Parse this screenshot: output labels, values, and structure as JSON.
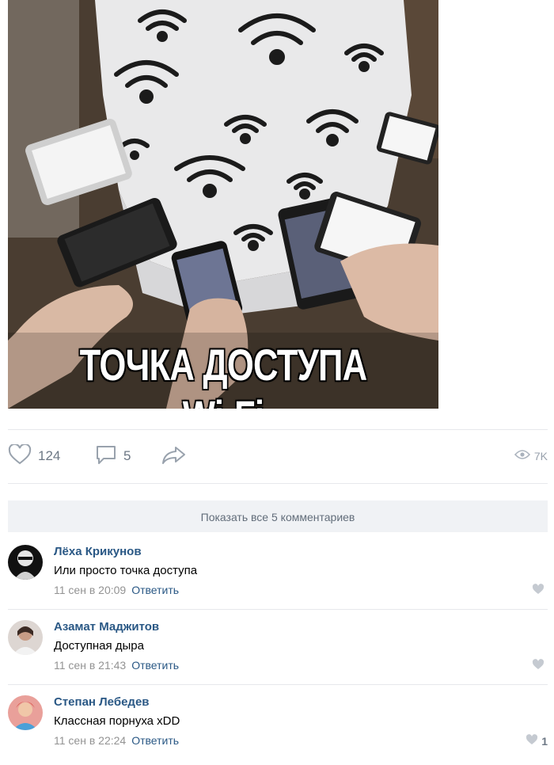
{
  "post": {
    "image_caption": "ТОЧКА ДОСТУПА Wi-Fi",
    "likes": "124",
    "comments": "5",
    "views": "7K"
  },
  "show_all_label": "Показать все 5 комментариев",
  "comments": [
    {
      "author": "Лёха Крикунов",
      "text": "Или просто точка доступа",
      "date": "11 сен в 20:09",
      "reply": "Ответить",
      "likes": ""
    },
    {
      "author": "Азамат Маджитов",
      "text": "Доступная дыра",
      "date": "11 сен в 21:43",
      "reply": "Ответить",
      "likes": ""
    },
    {
      "author": "Степан Лебедев",
      "text": "Классная порнуха xDD",
      "date": "11 сен в 22:24",
      "reply": "Ответить",
      "likes": "1"
    }
  ],
  "icons": {
    "like": "heart-outline-icon",
    "comment": "speech-bubble-icon",
    "share": "share-arrow-icon",
    "views": "eye-icon",
    "comment_like": "heart-filled-icon"
  },
  "colors": {
    "link": "#2a5885",
    "muted": "#939393",
    "icon": "#828282",
    "button_bg": "#f0f2f5",
    "divider": "#e7e8ec"
  }
}
